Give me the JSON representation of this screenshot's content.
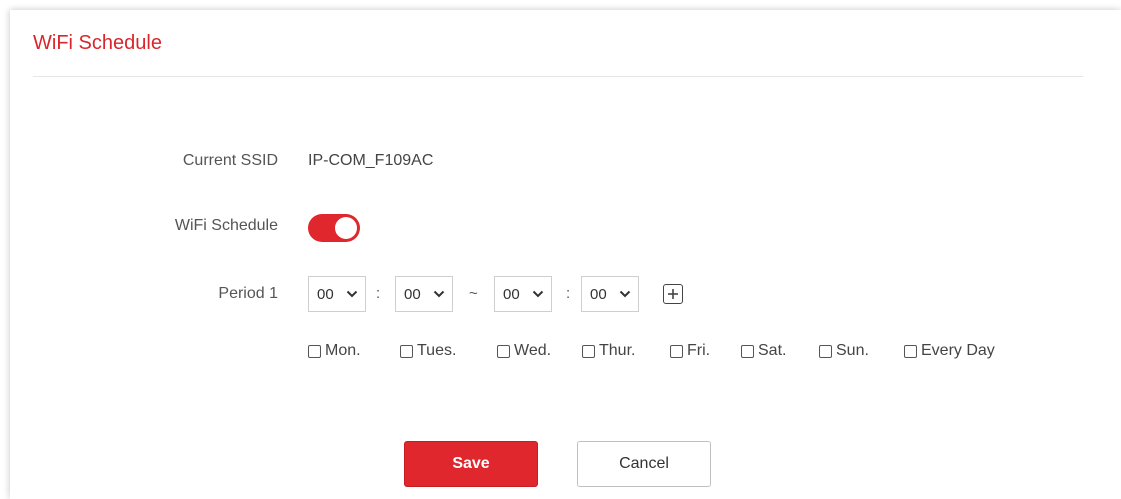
{
  "header": {
    "title": "WiFi Schedule"
  },
  "form": {
    "ssid_label": "Current SSID",
    "ssid_value": "IP-COM_F109AC",
    "schedule_label": "WiFi Schedule",
    "schedule_enabled": true,
    "period_label": "Period 1",
    "start_hour": "00",
    "start_minute": "00",
    "range_separator": "~",
    "time_separator": ":",
    "end_hour": "00",
    "end_minute": "00",
    "days": [
      {
        "label": "Mon.",
        "checked": false
      },
      {
        "label": "Tues.",
        "checked": false
      },
      {
        "label": "Wed.",
        "checked": false
      },
      {
        "label": "Thur.",
        "checked": false
      },
      {
        "label": "Fri.",
        "checked": false
      },
      {
        "label": "Sat.",
        "checked": false
      },
      {
        "label": "Sun.",
        "checked": false
      },
      {
        "label": "Every Day",
        "checked": false
      }
    ]
  },
  "actions": {
    "save_label": "Save",
    "cancel_label": "Cancel"
  },
  "icons": {
    "dropdown": "chevron-down-icon",
    "add": "plus-square-icon",
    "checkbox": "checkbox-unchecked-icon"
  },
  "colors": {
    "accent": "#e0272d",
    "title": "#d9262c"
  }
}
